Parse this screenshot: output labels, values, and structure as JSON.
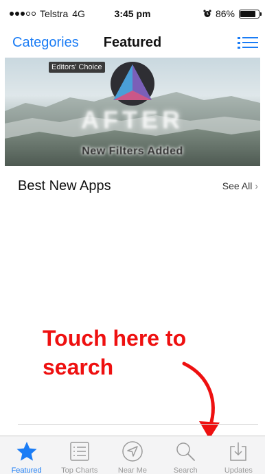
{
  "status_bar": {
    "carrier": "Telstra",
    "network": "4G",
    "time": "3:45 pm",
    "battery": "86%",
    "battery_level": 0.86,
    "signal_filled": 3,
    "signal_total": 5,
    "icons": [
      "signal-dots-icon",
      "alarm-clock-icon",
      "battery-icon"
    ]
  },
  "nav": {
    "left_label": "Categories",
    "title": "Featured",
    "right_icon": "list-icon"
  },
  "hero": {
    "badge": "Editors' Choice",
    "title": "AFTER",
    "caption": "New Filters Added"
  },
  "section": {
    "title": "Best New Apps",
    "see_all": "See All"
  },
  "callout": {
    "line1": "Touch here to",
    "line2": "search",
    "color": "#ee1010"
  },
  "tabs": [
    {
      "label": "Featured",
      "icon": "star-icon",
      "active": true
    },
    {
      "label": "Top Charts",
      "icon": "list-icon",
      "active": false
    },
    {
      "label": "Near Me",
      "icon": "navigation-arrow-icon",
      "active": false
    },
    {
      "label": "Search",
      "icon": "search-icon",
      "active": false
    },
    {
      "label": "Updates",
      "icon": "download-tray-icon",
      "active": false
    }
  ],
  "colors": {
    "accent": "#1a7cf5",
    "inactive_tab": "#9a9a9a",
    "callout": "#ee1010"
  }
}
